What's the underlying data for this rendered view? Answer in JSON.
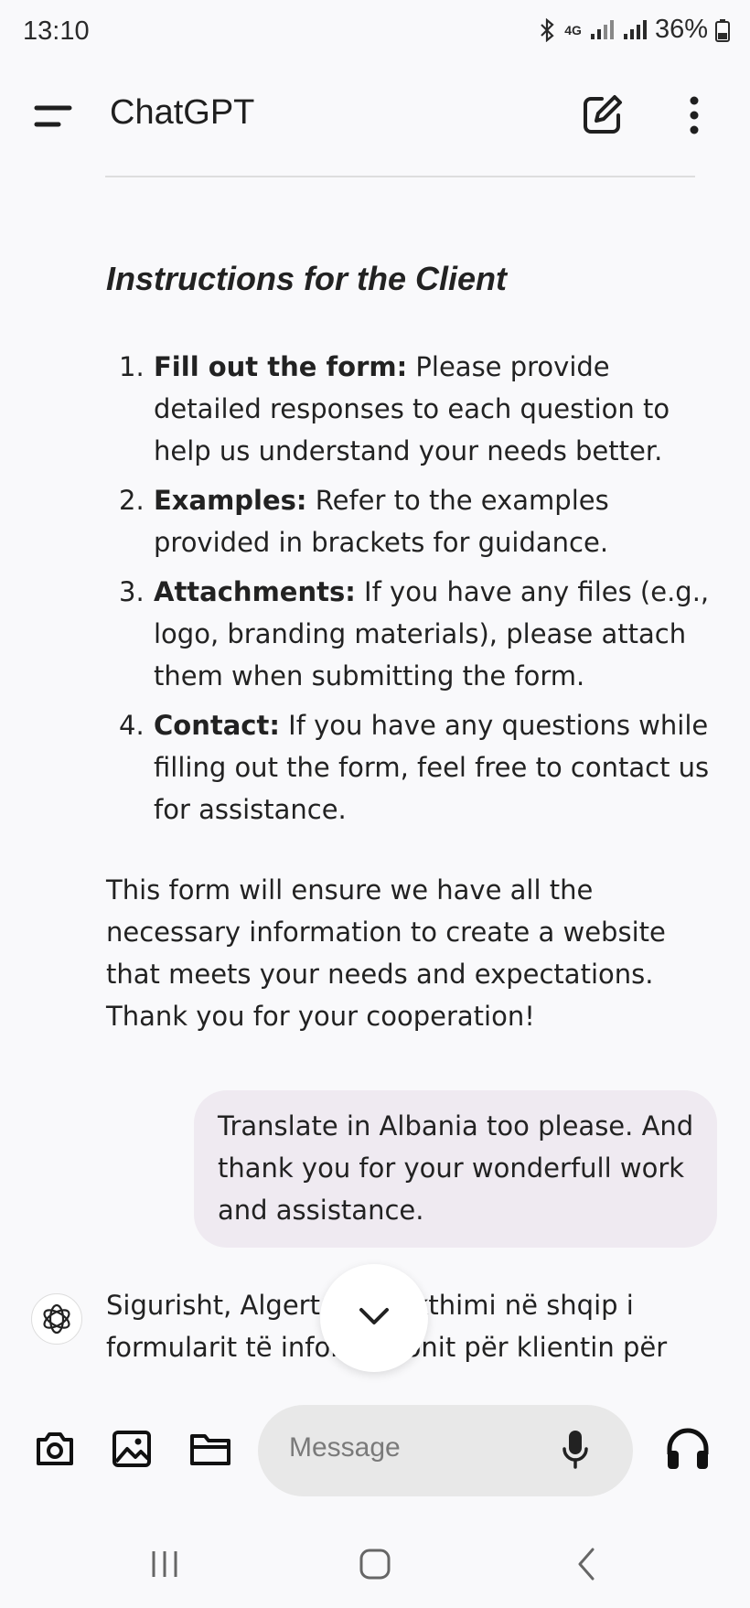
{
  "status_bar": {
    "time": "13:10",
    "network": "4G",
    "battery": "36%"
  },
  "top_bar": {
    "title": "ChatGPT"
  },
  "assistant_message": {
    "heading": "Instructions for the Client",
    "items": [
      {
        "num": "1.",
        "bold": "Fill out the form:",
        "text": " Please provide detailed responses to each question to help us understand your needs better."
      },
      {
        "num": "2.",
        "bold": "Examples:",
        "text": " Refer to the examples provided in brackets for guidance."
      },
      {
        "num": "3.",
        "bold": "Attachments:",
        "text": " If you have any files (e.g., logo, branding materials), please attach them when submitting the form."
      },
      {
        "num": "4.",
        "bold": "Contact:",
        "text": " If you have any questions while filling out the form, feel free to contact us for assistance."
      }
    ],
    "closing": "This form will ensure we have all the necessary information to create a website that meets your needs and expectations. Thank you for your cooperation!"
  },
  "user_message": {
    "text": "Translate in Albania too please. And thank you for your wonderfull work and assistance."
  },
  "assistant_reply": {
    "text": "Sigurisht, Algert, ja përkthimi në shqip i formularit të informacionit për klientin për"
  },
  "composer": {
    "placeholder": "Message"
  },
  "icons": {
    "menu": "menu-icon",
    "new_chat": "edit-icon",
    "more": "more-vertical-icon",
    "camera": "camera-icon",
    "image": "image-icon",
    "files": "folder-icon",
    "mic": "microphone-icon",
    "voice": "headphones-icon",
    "scroll": "chevron-down-icon"
  }
}
